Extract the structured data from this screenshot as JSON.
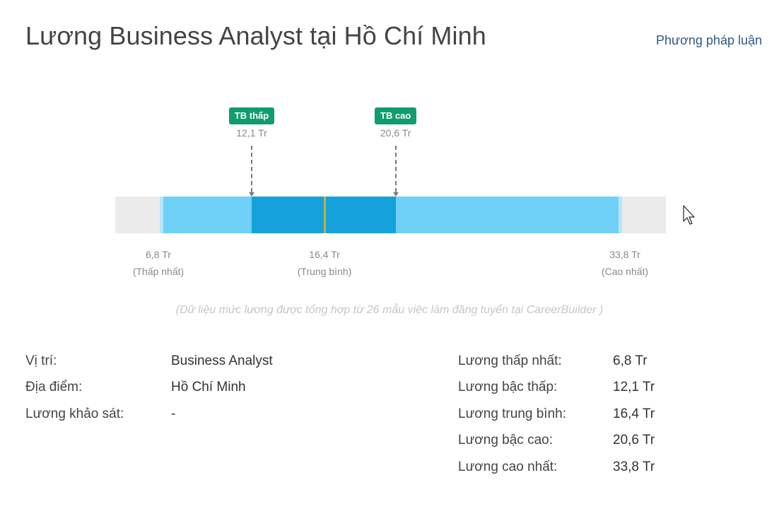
{
  "header": {
    "title": "Lương Business Analyst tại Hồ Chí Minh",
    "methodology_link": "Phương pháp luận"
  },
  "chart_data": {
    "type": "range",
    "unit": "Tr",
    "min": {
      "value": 6.8,
      "label": "6,8 Tr",
      "caption": "(Thấp nhất)"
    },
    "low_avg": {
      "value": 12.1,
      "label": "12,1 Tr",
      "badge": "TB thấp"
    },
    "median": {
      "value": 16.4,
      "label": "16,4 Tr",
      "caption": "(Trung bình)"
    },
    "high_avg": {
      "value": 20.6,
      "label": "20,6 Tr",
      "badge": "TB cao"
    },
    "max": {
      "value": 33.8,
      "label": "33,8 Tr",
      "caption": "(Cao nhất)"
    },
    "colors": {
      "track": "#ebebeb",
      "range": "#6fd0f7",
      "core": "#15a2dc",
      "median": "#c8ad3a",
      "badge": "#0f9d6d"
    }
  },
  "note": "(Dữ liệu mức lương được tổng hợp từ 26 mẫu việc làm đăng tuyển tại CareerBuilder )",
  "details": {
    "left": [
      {
        "label": "Vị trí:",
        "value": "Business Analyst"
      },
      {
        "label": "Địa điểm:",
        "value": "Hồ Chí Minh"
      },
      {
        "label": "Lương khảo sát:",
        "value": "-"
      }
    ],
    "right": [
      {
        "label": "Lương thấp nhất:",
        "value": "6,8 Tr"
      },
      {
        "label": "Lương bậc thấp:",
        "value": "12,1 Tr"
      },
      {
        "label": "Lương trung bình:",
        "value": "16,4 Tr"
      },
      {
        "label": "Lương bậc cao:",
        "value": "20,6 Tr"
      },
      {
        "label": "Lương cao nhất:",
        "value": "33,8 Tr"
      }
    ]
  }
}
